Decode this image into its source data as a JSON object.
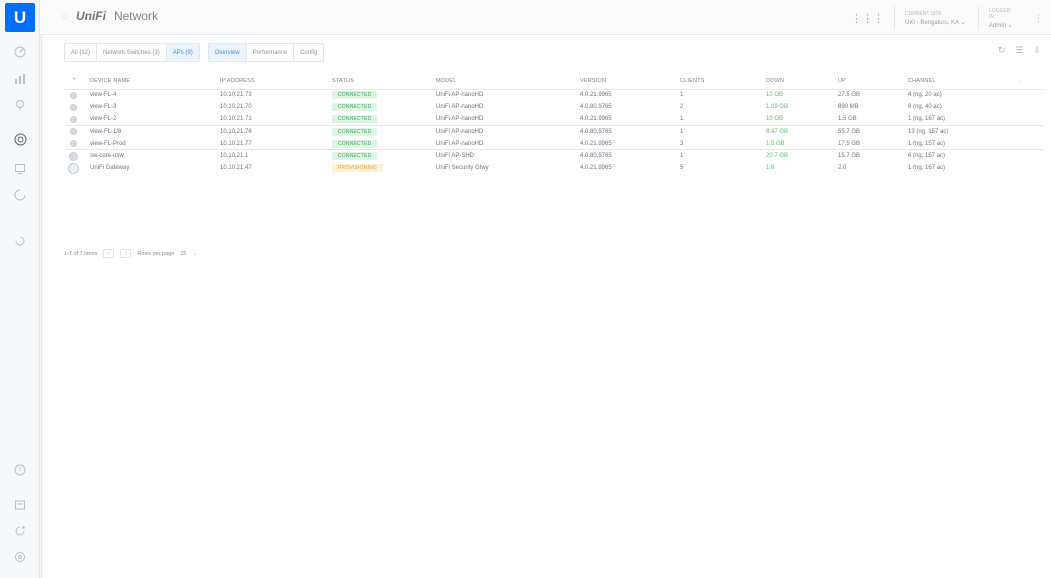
{
  "header": {
    "logo_letter": "U",
    "brand_mark": "UniFi",
    "app_name": "Network",
    "site_label": "CURRENT SITE",
    "site_value": "UXI - Bengaluru, KA ⌄",
    "user_label": "LOGGED IN",
    "user_value": "Admin ⌄"
  },
  "filters": {
    "device_filters": [
      "All (12)",
      "Network Switches (3)",
      "APs (9)"
    ],
    "view_tabs": [
      "Overview",
      "Performance",
      "Config"
    ]
  },
  "table": {
    "columns": [
      "DEVICE NAME",
      "IP ADDRESS",
      "STATUS",
      "MODEL",
      "VERSION",
      "CLIENTS",
      "DOWN",
      "UP",
      "CHANNEL"
    ],
    "rows": [
      {
        "name": "view-FL-4",
        "ip": "10.10.21.73",
        "status": "CONNECTED",
        "model": "UniFi AP-nanoHD",
        "version": "4.0.21.9965",
        "clients": "1",
        "down": "10 GB",
        "up": "27.5 GB",
        "channel": "4 (ng, 20 ac)"
      },
      {
        "name": "view-FL-3",
        "ip": "10.10.21.70",
        "status": "CONNECTED",
        "model": "UniFi AP-nanoHD",
        "version": "4.0.80.9765",
        "clients": "2",
        "down": "1.09 GB",
        "up": "890 MB",
        "channel": "6 (ng, 40 ac)"
      },
      {
        "name": "view-FL-2",
        "ip": "10.10.21.71",
        "status": "CONNECTED",
        "model": "UniFi AP-nanoHD",
        "version": "4.0.21.9965",
        "clients": "1",
        "down": "10 GB",
        "up": "1.5 GB",
        "channel": "1 (ng, 167 ac)"
      },
      {
        "name": "view-FL-1/8",
        "ip": "10.10.21.76",
        "status": "CONNECTED",
        "model": "UniFi AP-nanoHD",
        "version": "4.0.80.9765",
        "clients": "1",
        "down": "8.47 GB",
        "up": "55.7 GB",
        "channel": "13 (ng, 157 ac)"
      },
      {
        "name": "view-FL-Prod",
        "ip": "10.10.21.77",
        "status": "CONNECTED",
        "model": "UniFi AP-nanoHD",
        "version": "4.0.21.9965",
        "clients": "3",
        "down": "1.5 GB",
        "up": "17.5 GB",
        "channel": "1 (ng, 157 ac)"
      },
      {
        "name": "sw-core-usw",
        "ip": "10.10.21.1",
        "status": "CONNECTED",
        "model": "UniFi AP-SHD",
        "version": "4.0.80.9765",
        "clients": "1",
        "down": "20.7 GB",
        "up": "15.7 GB",
        "channel": "6 (ng, 157 ac)"
      },
      {
        "name": "UniFi Gateway",
        "ip": "10.10.21.47",
        "status": "PROVISIONING",
        "model": "UniFi Security Gtwy",
        "version": "4.0.21.9965",
        "clients": "5",
        "down": "1.8",
        "up": "2.0",
        "channel": "1 (ng, 167 ac)"
      }
    ]
  },
  "pager": {
    "range": "1-7 of 7 items",
    "per_page_label": "Rows per page",
    "per_page_value": "25"
  },
  "icons": {
    "nav_top": [
      "dashboard-icon",
      "statistics-icon",
      "map-icon",
      "devices-icon",
      "clients-icon",
      "insights-icon",
      "events-icon"
    ],
    "nav_bottom": [
      "alerts-icon",
      "notifications-icon",
      "support-icon",
      "settings-icon"
    ]
  },
  "colors": {
    "accent": "#006fff",
    "connected": "#38a95a",
    "warning": "#f29a2e"
  }
}
